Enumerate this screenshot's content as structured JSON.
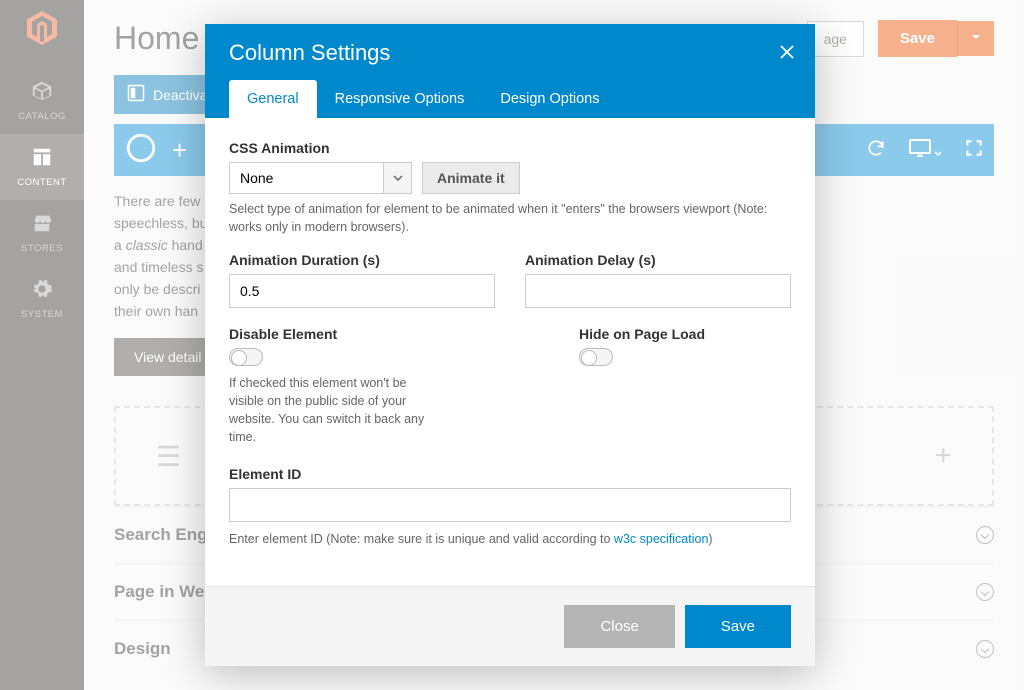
{
  "sidebar": {
    "items": [
      {
        "label": "CATALOG"
      },
      {
        "label": "CONTENT"
      },
      {
        "label": "STORES"
      },
      {
        "label": "SYSTEM"
      }
    ]
  },
  "page": {
    "title": "Home P",
    "back_fragment": "age",
    "save_label": "Save",
    "deactivate_label": "Deactiva",
    "body_text_l1": "There are few",
    "body_text_l2": "speechless, bu",
    "body_text_l3a": "a ",
    "body_text_l3b": "classic",
    "body_text_l3c": " hand",
    "body_text_l4": "and timeless s",
    "body_text_l5": "only be descri",
    "body_text_l6": "their own han",
    "view_details": "View detail",
    "accordions": [
      {
        "label": "Search Eng"
      },
      {
        "label": "Page in We"
      },
      {
        "label": "Design"
      }
    ]
  },
  "modal": {
    "title": "Column Settings",
    "tabs": [
      {
        "label": "General"
      },
      {
        "label": "Responsive Options"
      },
      {
        "label": "Design Options"
      }
    ],
    "css_anim": {
      "label": "CSS Animation",
      "value": "None",
      "button": "Animate it",
      "help": "Select type of animation for element to be animated when it \"enters\" the browsers viewport (Note: works only in modern browsers)."
    },
    "duration": {
      "label": "Animation Duration (s)",
      "value": "0.5"
    },
    "delay": {
      "label": "Animation Delay (s)",
      "value": ""
    },
    "disable": {
      "label": "Disable Element",
      "help": "If checked this element won't be visible on the public side of your website. You can switch it back any time."
    },
    "hide": {
      "label": "Hide on Page Load"
    },
    "element_id": {
      "label": "Element ID",
      "value": "",
      "help_pre": "Enter element ID (Note: make sure it is unique and valid according to ",
      "help_link": "w3c specification",
      "help_post": ")"
    },
    "footer": {
      "close": "Close",
      "save": "Save"
    }
  }
}
